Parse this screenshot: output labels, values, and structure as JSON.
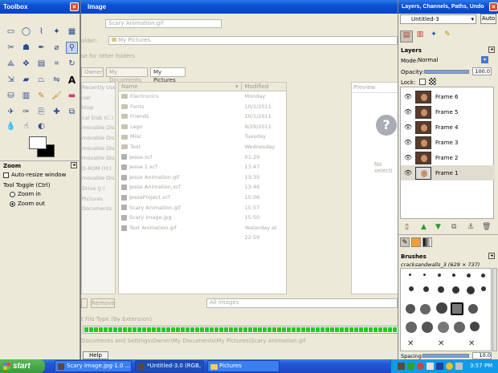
{
  "toolbox": {
    "title": "Toolbox",
    "zoom_title": "Zoom",
    "auto_resize": "Auto-resize window",
    "tool_toggle": "Tool Toggle (Ctrl)",
    "zoom_in": "Zoom in",
    "zoom_out": "Zoom out"
  },
  "dialog": {
    "title": "Image",
    "name_value": "Scary Animation.gif",
    "folder_label": "older:",
    "folder_value": "My Pictures",
    "browse_label": "se for other folders",
    "crumbs": [
      "Owner",
      "My Documents",
      "My Pictures"
    ],
    "places_items": [
      "Recently Used",
      "ner",
      "ktop",
      "cal Disk (C:)",
      "movable Disk (D:)",
      "movable Disk (E:)",
      "movable Disk (F:)",
      "movable Disk (G:)",
      "D-ROM (H:)",
      "movable Disk (I:)",
      "Drive (J:)",
      "Pictures",
      "Documents"
    ],
    "col_name": "Name",
    "col_modified": "Modified",
    "files": [
      {
        "name": "Electronics",
        "modified": "Monday"
      },
      {
        "name": "Fonts",
        "modified": "10/1/2011"
      },
      {
        "name": "Friends",
        "modified": "10/1/2011"
      },
      {
        "name": "Lego",
        "modified": "9/29/2011"
      },
      {
        "name": "Misc",
        "modified": "Tuesday"
      },
      {
        "name": "Text",
        "modified": "Wednesday"
      },
      {
        "name": "Jesse.xcf",
        "modified": "01:29"
      },
      {
        "name": "Jesse 1.xcf",
        "modified": "13:47"
      },
      {
        "name": "Jesse Animation.gif",
        "modified": "13:35"
      },
      {
        "name": "Jesse Animation.xcf",
        "modified": "13:46"
      },
      {
        "name": "JesseProject.xcf",
        "modified": "15:06"
      },
      {
        "name": "Scary Animation.gif",
        "modified": "15:57"
      },
      {
        "name": "Scary Image.jpg",
        "modified": "15:50"
      },
      {
        "name": "Text Animation.gif",
        "modified": "Yesterday at 22:59"
      }
    ],
    "preview_label": "Preview",
    "no_selection": "No selecti",
    "remove_label": "Remove",
    "filter_value": "All images",
    "file_type": "t File Type (By Extension)",
    "path": "Documents and Settings\\Owner\\My Documents\\My Pictures\\Scary Animation.gif",
    "help_label": "Help",
    "progress": 1.0
  },
  "dock": {
    "title": "Layers, Channels, Paths, Undo",
    "image_select": "Untitled-3",
    "auto_label": "Auto",
    "layers_title": "Layers",
    "mode_label": "Mode:",
    "mode_value": "Normal",
    "opacity_label": "Opacity:",
    "opacity_value": "100.0",
    "lock_label": "Lock:",
    "layers": [
      "Frame 6",
      "Frame 5",
      "Frame 4",
      "Frame 3",
      "Frame 2",
      "Frame 1"
    ],
    "brushes_title": "Brushes",
    "brush_name": "cracksandwalls_3 (629 × 737)",
    "spacing_label": "Spacing:",
    "spacing_value": "10.0"
  },
  "taskbar": {
    "start": "start",
    "items": [
      "Scary Image.jpg-1.0 ...",
      "*Untitled-3.0 (RGB, 6...",
      "Pictures"
    ],
    "time": "3:57 PM"
  }
}
